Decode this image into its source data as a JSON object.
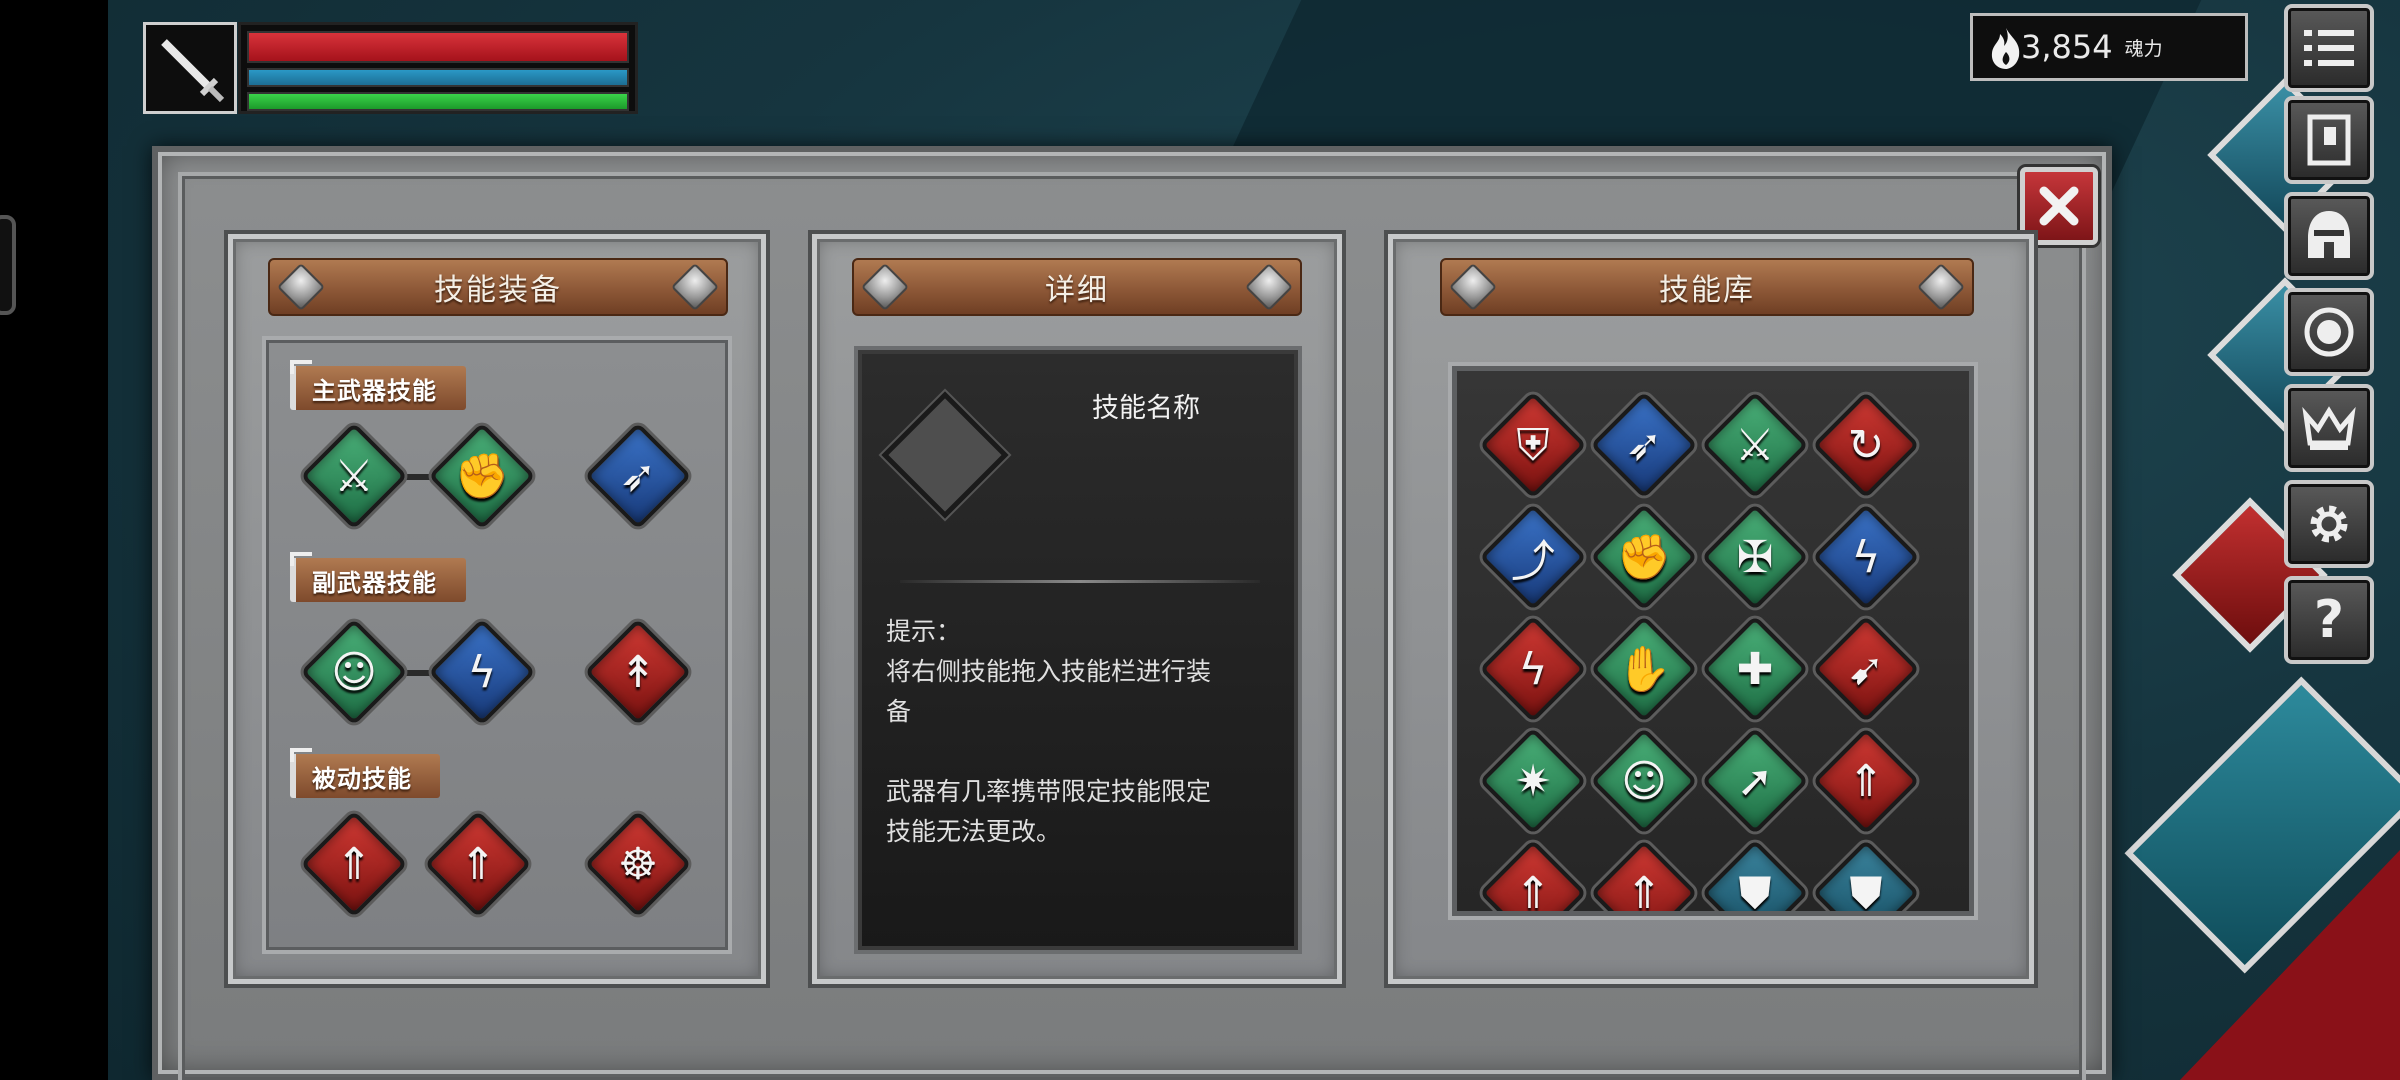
{
  "hud": {
    "weapon_icon": "sword-icon",
    "hp_fraction": 1.0,
    "mp_fraction": 1.0,
    "stamina_fraction": 1.0,
    "soul_count": "3,854",
    "soul_unit": "魂力",
    "soul_icon": "flame-icon"
  },
  "menu": {
    "items": [
      {
        "name": "menu-icon"
      },
      {
        "name": "map-icon"
      },
      {
        "name": "helmet-icon"
      },
      {
        "name": "medallion-icon"
      },
      {
        "name": "crown-icon"
      },
      {
        "name": "gear-icon"
      },
      {
        "name": "help-icon",
        "label": "?"
      }
    ]
  },
  "equip_panel": {
    "title": "技能装备",
    "main_weapon": {
      "label": "主武器技能",
      "skills": [
        {
          "icon": "sword-lightning-icon",
          "color": "green"
        },
        {
          "icon": "fist-icon",
          "color": "green"
        },
        {
          "icon": "dash-icon",
          "color": "blue"
        }
      ]
    },
    "sub_weapon": {
      "label": "副武器技能",
      "skills": [
        {
          "icon": "brain-head-icon",
          "color": "green"
        },
        {
          "icon": "lightning-bolt-icon",
          "color": "blue"
        },
        {
          "icon": "spear-icon",
          "color": "red"
        }
      ]
    },
    "passive": {
      "label": "被动技能",
      "skills": [
        {
          "icon": "sword-upgrade-icon",
          "color": "red"
        },
        {
          "icon": "sword-upgrade-icon",
          "color": "red"
        },
        {
          "icon": "fire-rune-icon",
          "color": "red"
        }
      ]
    }
  },
  "detail_panel": {
    "title": "详细",
    "skill_name": "技能名称",
    "hint_title": "提示：",
    "hint_line1": "将右侧技能拖入技能栏进行装",
    "hint_line2": "备",
    "note_line1": "武器有几率携带限定技能限定",
    "note_line2": "技能无法更改。"
  },
  "library_panel": {
    "title": "技能库",
    "skills": [
      {
        "icon": "shield-slam-icon",
        "color": "red"
      },
      {
        "icon": "dash-icon",
        "color": "blue"
      },
      {
        "icon": "sword-lightning-icon",
        "color": "green"
      },
      {
        "icon": "whirlwind-icon",
        "color": "red"
      },
      {
        "icon": "leap-icon",
        "color": "blue"
      },
      {
        "icon": "fist-icon",
        "color": "green"
      },
      {
        "icon": "double-axe-icon",
        "color": "green"
      },
      {
        "icon": "lightning-bolt-icon",
        "color": "blue"
      },
      {
        "icon": "red-lightning-icon",
        "color": "red"
      },
      {
        "icon": "praying-hands-icon",
        "color": "green"
      },
      {
        "icon": "healer-icon",
        "color": "green"
      },
      {
        "icon": "lunge-icon",
        "color": "red"
      },
      {
        "icon": "burst-icon",
        "color": "green"
      },
      {
        "icon": "brain-head-icon",
        "color": "green"
      },
      {
        "icon": "throw-icon",
        "color": "green"
      },
      {
        "icon": "sword-upgrade-icon",
        "color": "red"
      },
      {
        "icon": "sword-upgrade-icon",
        "color": "red"
      },
      {
        "icon": "sword-upgrade-icon",
        "color": "red"
      },
      {
        "icon": "shield-upgrade-icon",
        "color": "teal"
      },
      {
        "icon": "shield-upgrade-icon",
        "color": "teal"
      }
    ]
  },
  "colors": {
    "hp": "#c3232b",
    "mp": "#2586b0",
    "stamina": "#2bbf3a",
    "panel_gray": "#8a8c8d",
    "plank_wood": "#8a5535"
  }
}
